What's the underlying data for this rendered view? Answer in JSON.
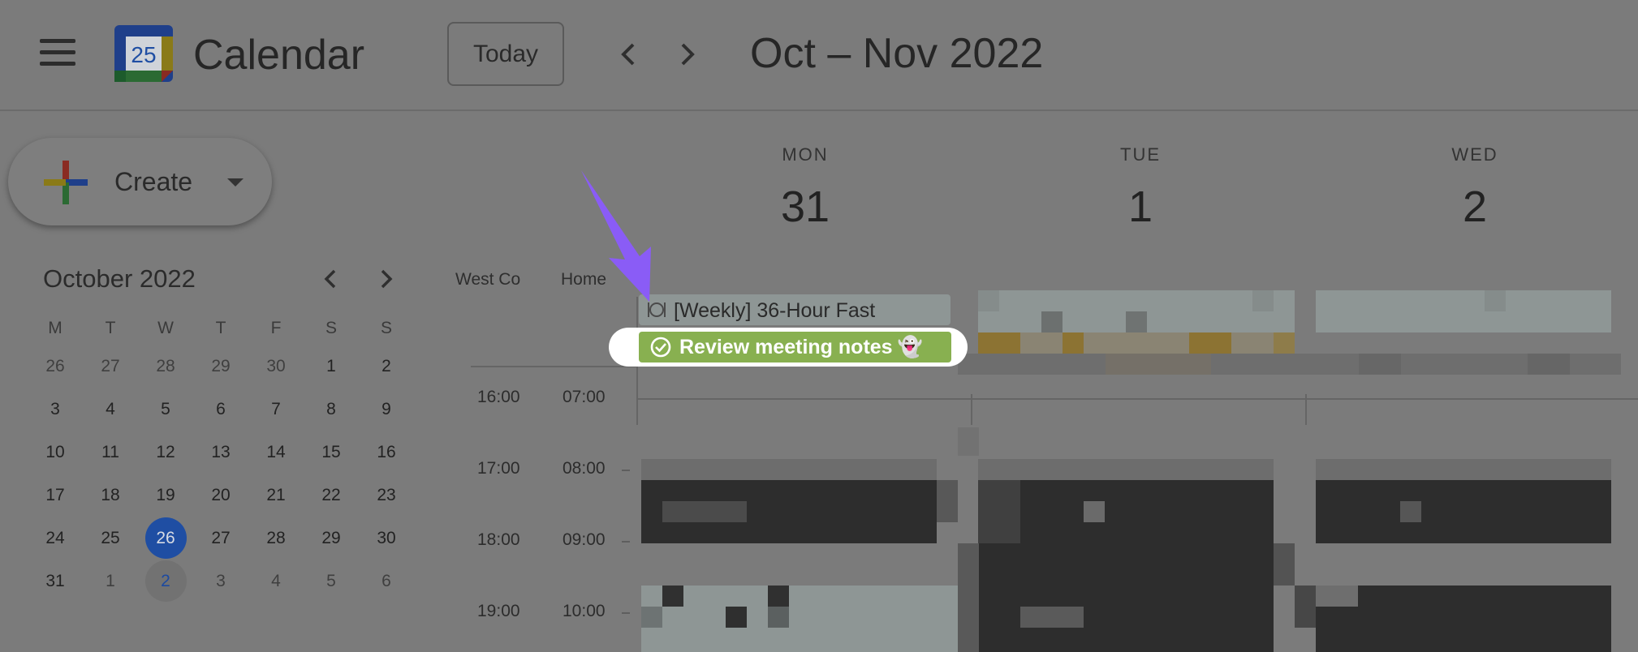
{
  "header": {
    "app_title": "Calendar",
    "logo_day": "25",
    "today_label": "Today",
    "date_range": "Oct – Nov 2022"
  },
  "sidebar": {
    "create_label": "Create",
    "mini_calendar": {
      "title": "October 2022",
      "weekdays": [
        "M",
        "T",
        "W",
        "T",
        "F",
        "S",
        "S"
      ],
      "weeks": [
        [
          "26",
          "27",
          "28",
          "29",
          "30",
          "1",
          "2"
        ],
        [
          "3",
          "4",
          "5",
          "6",
          "7",
          "8",
          "9"
        ],
        [
          "10",
          "11",
          "12",
          "13",
          "14",
          "15",
          "16"
        ],
        [
          "17",
          "18",
          "19",
          "20",
          "21",
          "22",
          "23"
        ],
        [
          "24",
          "25",
          "26",
          "27",
          "28",
          "29",
          "30"
        ],
        [
          "31",
          "1",
          "2",
          "3",
          "4",
          "5",
          "6"
        ]
      ],
      "today": "26",
      "selected": "2"
    }
  },
  "main": {
    "timezones": [
      "West Co",
      "Home"
    ],
    "days": [
      {
        "dow": "MON",
        "num": "31"
      },
      {
        "dow": "TUE",
        "num": "1"
      },
      {
        "dow": "WED",
        "num": "2"
      }
    ],
    "hours": [
      {
        "primary": "16:00",
        "secondary": "07:00"
      },
      {
        "primary": "17:00",
        "secondary": "08:00"
      },
      {
        "primary": "18:00",
        "secondary": "09:00"
      },
      {
        "primary": "19:00",
        "secondary": "10:00"
      }
    ],
    "events": {
      "fast": {
        "title": "[Weekly] 36-Hour Fast",
        "icon": "fork-knife-icon"
      },
      "task": {
        "title": "Review meeting notes",
        "emoji": "👻",
        "color": "#88b050"
      }
    }
  },
  "colors": {
    "overlay": "#7b7b7b",
    "arrow": "#8a5cf6",
    "today_circle": "#1f4ea3",
    "task_green": "#88b050"
  }
}
